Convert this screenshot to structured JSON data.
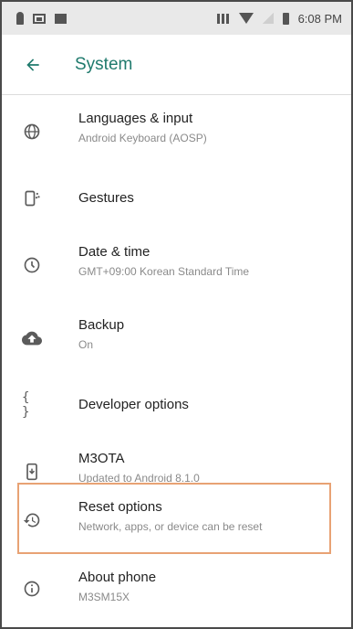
{
  "status_bar": {
    "time": "6:08 PM",
    "left_icons": [
      "person-icon",
      "image-icon",
      "message-icon"
    ],
    "right_icons": [
      "vibrate-icon",
      "wifi-icon",
      "no-signal-icon",
      "battery-icon"
    ]
  },
  "toolbar": {
    "title": "System",
    "back_icon": "arrow-left-icon"
  },
  "items": [
    {
      "icon": "globe-icon",
      "title": "Languages & input",
      "subtitle": "Android Keyboard (AOSP)"
    },
    {
      "icon": "gestures-icon",
      "title": "Gestures",
      "subtitle": ""
    },
    {
      "icon": "clock-icon",
      "title": "Date & time",
      "subtitle": "GMT+09:00 Korean Standard Time"
    },
    {
      "icon": "cloud-upload-icon",
      "title": "Backup",
      "subtitle": "On"
    },
    {
      "icon": "braces-icon",
      "title": "Developer options",
      "subtitle": ""
    },
    {
      "icon": "system-update-icon",
      "title": "M3OTA",
      "subtitle": "Updated to Android 8.1.0"
    },
    {
      "icon": "history-icon",
      "title": "Reset options",
      "subtitle": "Network, apps, or device can be reset"
    },
    {
      "icon": "info-icon",
      "title": "About phone",
      "subtitle": "M3SM15X"
    }
  ],
  "colors": {
    "accent": "#1f7a6d",
    "highlight_border": "#e8a274",
    "status_bar_bg": "#e9e9e9"
  }
}
